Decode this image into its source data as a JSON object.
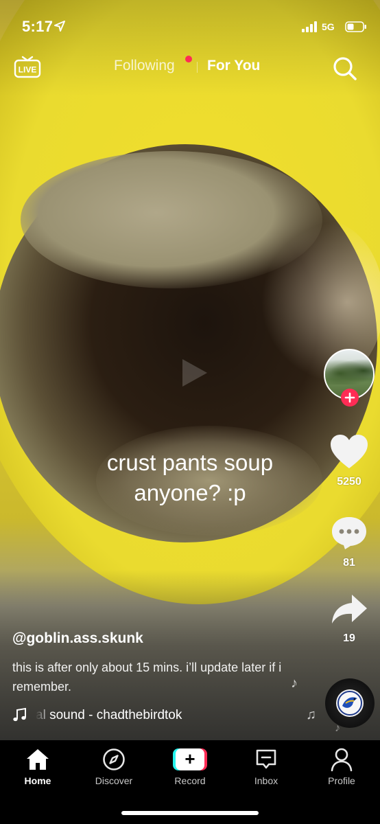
{
  "status_bar": {
    "time": "5:17",
    "network": "5G",
    "icons": [
      "location-arrow-icon",
      "signal-bars-icon",
      "battery-icon"
    ]
  },
  "top_nav": {
    "live_label": "LIVE",
    "tabs": [
      {
        "label": "Following",
        "has_notification_dot": true,
        "active": false
      },
      {
        "label": "For You",
        "active": true
      }
    ],
    "search_icon": "search-icon"
  },
  "video": {
    "caption_lines": [
      "crust pants soup",
      "anyone? :p"
    ]
  },
  "actions": {
    "follow_icon": "plus-icon",
    "likes": "5250",
    "comments": "81",
    "shares": "19"
  },
  "post": {
    "username": "@goblin.ass.skunk",
    "description": "this is after only about 15 mins. i’ll update later if i remember.",
    "sound": "al sound - chadthebirdtok"
  },
  "bottom_nav": {
    "items": [
      {
        "label": "Home",
        "icon": "home-icon",
        "active": true
      },
      {
        "label": "Discover",
        "icon": "compass-icon",
        "active": false
      },
      {
        "label": "Record",
        "icon": "plus-icon",
        "active": false
      },
      {
        "label": "Inbox",
        "icon": "inbox-icon",
        "active": false
      },
      {
        "label": "Profile",
        "icon": "person-icon",
        "active": false
      }
    ]
  },
  "colors": {
    "accent_red": "#fe2c55",
    "accent_cyan": "#25f4ee",
    "bowl_yellow": "#eadb2f"
  }
}
